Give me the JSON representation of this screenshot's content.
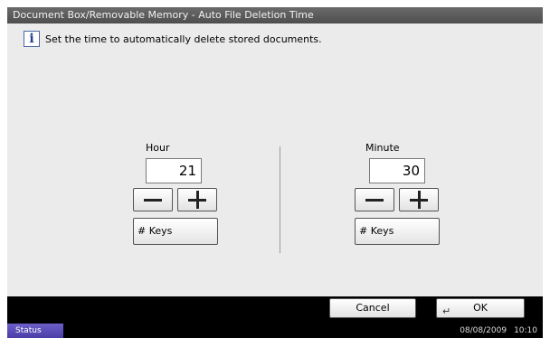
{
  "window": {
    "title": "Document Box/Removable Memory - Auto File Deletion Time"
  },
  "message": {
    "icon": "info-icon",
    "text": "Set the time to automatically delete stored documents."
  },
  "hour": {
    "label": "Hour",
    "value": "21",
    "keys_label": "# Keys"
  },
  "minute": {
    "label": "Minute",
    "value": "30",
    "keys_label": "# Keys"
  },
  "buttons": {
    "cancel_label": "Cancel",
    "ok_label": "OK"
  },
  "status": {
    "label": "Status",
    "date": "08/08/2009",
    "time": "10:10"
  },
  "colors": {
    "title_bar": "#5a5a5a",
    "panel_background": "#ebebeb",
    "status_button": "#5a4cb8"
  }
}
